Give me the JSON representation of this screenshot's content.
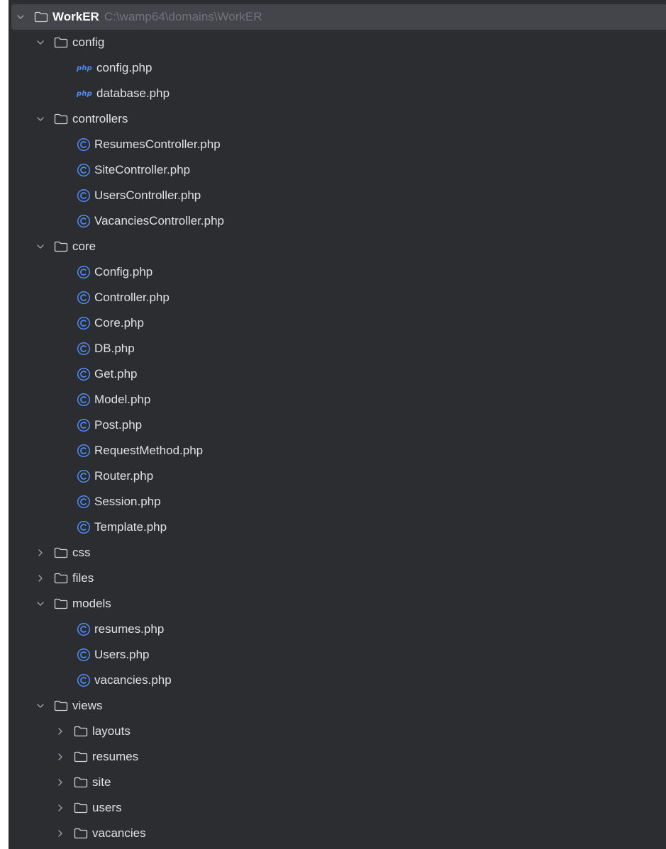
{
  "project_tree": {
    "root_path": "C:\\wamp64\\domains\\WorkER",
    "items": [
      {
        "label": "WorkER",
        "kind": "folder",
        "depth": 0,
        "expanded": true,
        "selected": true,
        "bold": true,
        "name": "project-root"
      },
      {
        "label": "config",
        "kind": "folder",
        "depth": 1,
        "expanded": true,
        "name": "config"
      },
      {
        "label": "config.php",
        "kind": "php",
        "depth": 2,
        "name": "config-php"
      },
      {
        "label": "database.php",
        "kind": "php",
        "depth": 2,
        "name": "database-php"
      },
      {
        "label": "controllers",
        "kind": "folder",
        "depth": 1,
        "expanded": true,
        "name": "controllers"
      },
      {
        "label": "ResumesController.php",
        "kind": "class",
        "depth": 2,
        "name": "resumescontroller-php"
      },
      {
        "label": "SiteController.php",
        "kind": "class",
        "depth": 2,
        "name": "sitecontroller-php"
      },
      {
        "label": "UsersController.php",
        "kind": "class",
        "depth": 2,
        "name": "userscontroller-php"
      },
      {
        "label": "VacanciesController.php",
        "kind": "class",
        "depth": 2,
        "name": "vacanciescontroller-php"
      },
      {
        "label": "core",
        "kind": "folder",
        "depth": 1,
        "expanded": true,
        "name": "core"
      },
      {
        "label": "Config.php",
        "kind": "class",
        "depth": 2,
        "name": "core-config-php"
      },
      {
        "label": "Controller.php",
        "kind": "class",
        "depth": 2,
        "name": "controller-php"
      },
      {
        "label": "Core.php",
        "kind": "class",
        "depth": 2,
        "name": "core-php"
      },
      {
        "label": "DB.php",
        "kind": "class",
        "depth": 2,
        "name": "db-php"
      },
      {
        "label": "Get.php",
        "kind": "class",
        "depth": 2,
        "name": "get-php"
      },
      {
        "label": "Model.php",
        "kind": "class",
        "depth": 2,
        "name": "model-php"
      },
      {
        "label": "Post.php",
        "kind": "class",
        "depth": 2,
        "name": "post-php"
      },
      {
        "label": "RequestMethod.php",
        "kind": "class",
        "depth": 2,
        "name": "requestmethod-php"
      },
      {
        "label": "Router.php",
        "kind": "class",
        "depth": 2,
        "name": "router-php"
      },
      {
        "label": "Session.php",
        "kind": "class",
        "depth": 2,
        "name": "session-php"
      },
      {
        "label": "Template.php",
        "kind": "class",
        "depth": 2,
        "name": "template-php"
      },
      {
        "label": "css",
        "kind": "folder",
        "depth": 1,
        "expanded": false,
        "name": "css"
      },
      {
        "label": "files",
        "kind": "folder",
        "depth": 1,
        "expanded": false,
        "name": "files"
      },
      {
        "label": "models",
        "kind": "folder",
        "depth": 1,
        "expanded": true,
        "name": "models"
      },
      {
        "label": "resumes.php",
        "kind": "class",
        "depth": 2,
        "name": "resumes-php"
      },
      {
        "label": "Users.php",
        "kind": "class",
        "depth": 2,
        "name": "users-php"
      },
      {
        "label": "vacancies.php",
        "kind": "class",
        "depth": 2,
        "name": "vacancies-php"
      },
      {
        "label": "views",
        "kind": "folder",
        "depth": 1,
        "expanded": true,
        "name": "views"
      },
      {
        "label": "layouts",
        "kind": "folder",
        "depth": 2,
        "expanded": false,
        "name": "views-layouts"
      },
      {
        "label": "resumes",
        "kind": "folder",
        "depth": 2,
        "expanded": false,
        "name": "views-resumes"
      },
      {
        "label": "site",
        "kind": "folder",
        "depth": 2,
        "expanded": false,
        "name": "views-site"
      },
      {
        "label": "users",
        "kind": "folder",
        "depth": 2,
        "expanded": false,
        "name": "views-users"
      },
      {
        "label": "vacancies",
        "kind": "folder",
        "depth": 2,
        "expanded": false,
        "name": "views-vacancies"
      }
    ]
  },
  "icons": {
    "folder": "folder-icon",
    "class": "php-class-icon",
    "php": "php-file-icon",
    "php_badge": "php",
    "chevron_expanded": "chevron-down-icon",
    "chevron_collapsed": "chevron-right-icon"
  },
  "colors": {
    "panel_bg": "#2b2d30",
    "selected_bg": "#43454a",
    "text": "#dfe1e5",
    "path_text": "#6f737a",
    "class_icon": "#4f8cf7",
    "folder_icon": "#cfd1d6"
  }
}
